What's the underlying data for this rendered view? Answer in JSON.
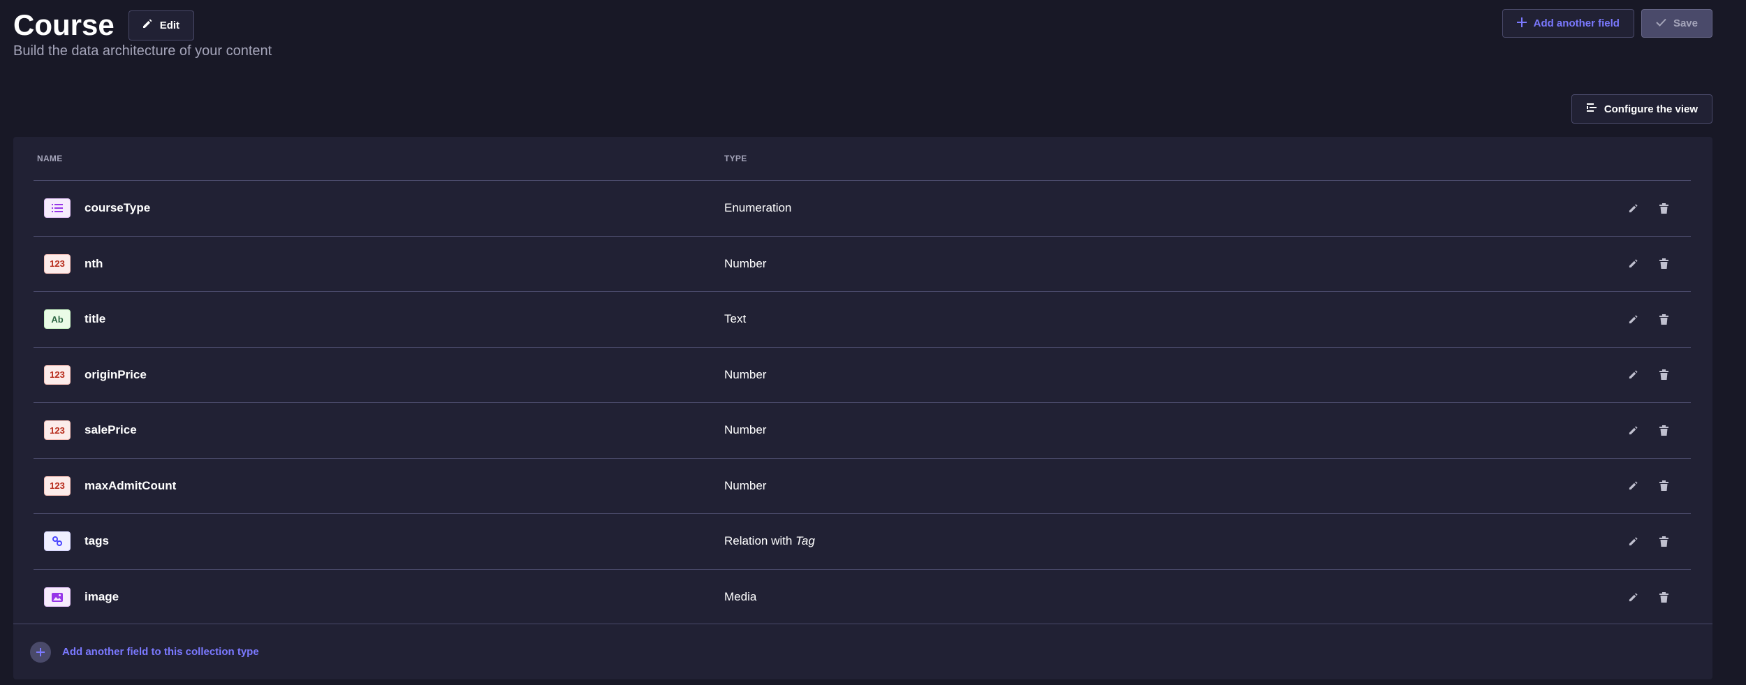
{
  "header": {
    "title": "Course",
    "edit_label": "Edit",
    "subtitle": "Build the data architecture of your content",
    "add_field_label": "Add another field",
    "save_label": "Save",
    "configure_label": "Configure the view"
  },
  "table": {
    "columns": [
      "NAME",
      "TYPE"
    ],
    "rows": [
      {
        "icon_label": "",
        "name": "courseType",
        "type": "Enumeration"
      },
      {
        "icon_label": "123",
        "name": "nth",
        "type": "Number"
      },
      {
        "icon_label": "Ab",
        "name": "title",
        "type": "Text"
      },
      {
        "icon_label": "123",
        "name": "originPrice",
        "type": "Number"
      },
      {
        "icon_label": "123",
        "name": "salePrice",
        "type": "Number"
      },
      {
        "icon_label": "123",
        "name": "maxAdmitCount",
        "type": "Number"
      },
      {
        "icon_label": "",
        "name": "tags",
        "type": "Relation with",
        "relation_target": "Tag"
      },
      {
        "icon_label": "",
        "name": "image",
        "type": "Media"
      }
    ]
  },
  "footer": {
    "add_field_label": "Add another field to this collection type"
  },
  "icons": {
    "edit": "pencil-icon",
    "add": "plus-icon",
    "save": "check-icon",
    "configure": "list-settings-icon",
    "row_edit": "pencil-icon",
    "row_delete": "trash-icon",
    "enumeration": "list-icon",
    "relation": "link-icon",
    "media": "image-icon"
  },
  "colors": {
    "background": "#181826",
    "card": "#212134",
    "accent": "#7b79ff",
    "border": "#4a4a6a"
  }
}
